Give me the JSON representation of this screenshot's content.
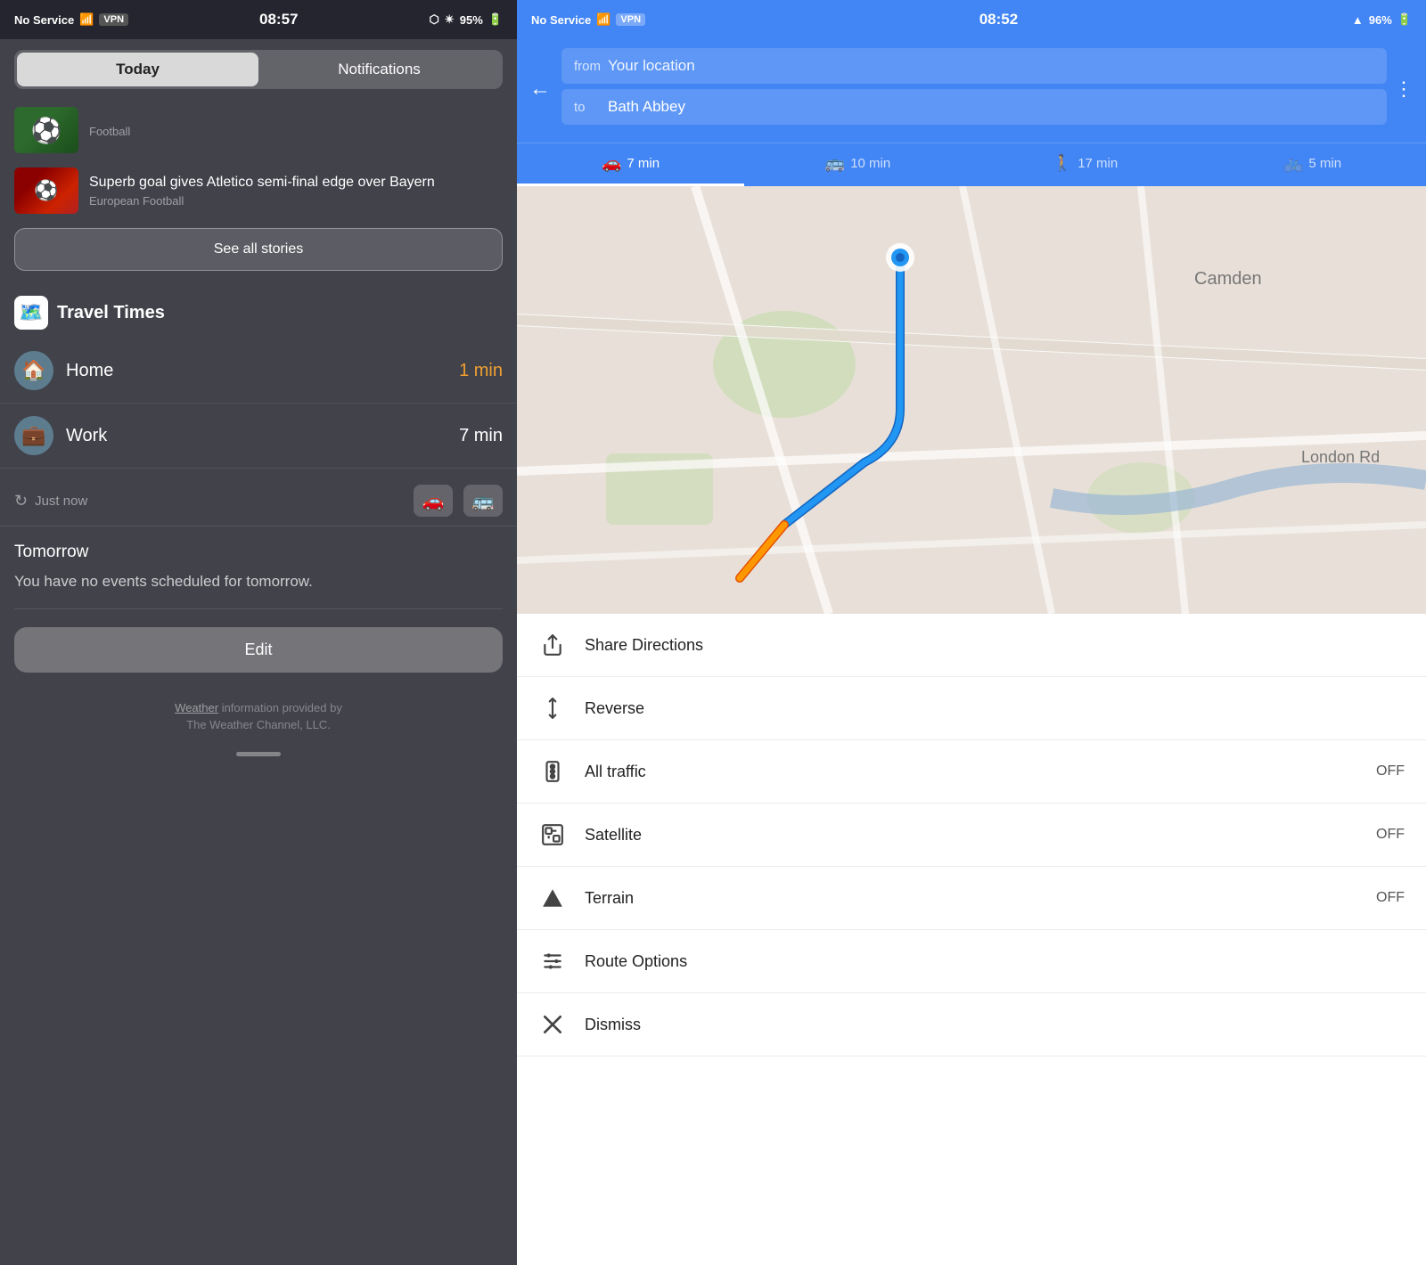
{
  "left": {
    "statusBar": {
      "carrier": "No Service",
      "wifi": "WiFi",
      "vpn": "VPN",
      "time": "08:57",
      "bluetooth": "BT",
      "battery": "95%"
    },
    "tabs": [
      {
        "label": "Today",
        "active": true
      },
      {
        "label": "Notifications",
        "active": false
      }
    ],
    "news": [
      {
        "category": "Football",
        "headline": "",
        "thumbType": "football"
      },
      {
        "category": "European Football",
        "headline": "Superb goal gives Atletico semi-final edge over Bayern",
        "thumbType": "atletico"
      }
    ],
    "seeAllLabel": "See all stories",
    "travelTimes": {
      "title": "Travel Times",
      "items": [
        {
          "label": "Home",
          "time": "1 min",
          "timeColor": "orange",
          "icon": "🏠"
        },
        {
          "label": "Work",
          "time": "7 min",
          "timeColor": "white",
          "icon": "💼"
        }
      ]
    },
    "refreshBar": {
      "text": "Just now"
    },
    "tomorrow": {
      "title": "Tomorrow",
      "text": "You have no events scheduled for tomorrow."
    },
    "editLabel": "Edit",
    "footer": {
      "text1": "Weather",
      "text2": " information provided by",
      "text3": "The Weather Channel, LLC."
    },
    "handleLabel": ""
  },
  "right": {
    "statusBar": {
      "carrier": "No Service",
      "wifi": "WiFi",
      "vpn": "VPN",
      "time": "08:52",
      "battery": "96%"
    },
    "route": {
      "fromLabel": "from",
      "fromValue": "Your location",
      "toLabel": "to",
      "toValue": "Bath Abbey"
    },
    "transportTabs": [
      {
        "icon": "🚗",
        "label": "7 min",
        "active": true
      },
      {
        "icon": "🚌",
        "label": "10 min",
        "active": false
      },
      {
        "icon": "🚶",
        "label": "17 min",
        "active": false
      },
      {
        "icon": "🚲",
        "label": "5 min",
        "active": false
      }
    ],
    "menu": [
      {
        "icon": "share",
        "label": "Share Directions",
        "value": ""
      },
      {
        "icon": "reverse",
        "label": "Reverse",
        "value": ""
      },
      {
        "icon": "traffic",
        "label": "All traffic",
        "value": "OFF"
      },
      {
        "icon": "satellite",
        "label": "Satellite",
        "value": "OFF"
      },
      {
        "icon": "terrain",
        "label": "Terrain",
        "value": "OFF"
      },
      {
        "icon": "route",
        "label": "Route Options",
        "value": ""
      },
      {
        "icon": "dismiss",
        "label": "Dismiss",
        "value": ""
      }
    ]
  }
}
